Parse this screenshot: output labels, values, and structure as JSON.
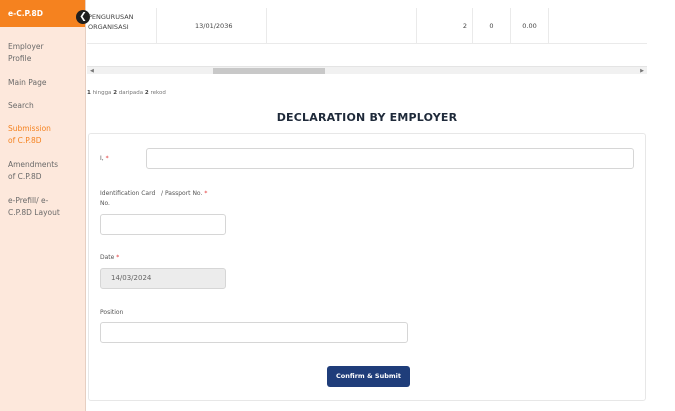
{
  "sidebar": {
    "header": "e-C.P.8D",
    "items": [
      {
        "label": "Employer Profile",
        "lines": [
          "Employer",
          "Profile"
        ],
        "active": false
      },
      {
        "label": "Main Page",
        "lines": [
          "Main Page"
        ],
        "active": false
      },
      {
        "label": "Search",
        "lines": [
          "Search"
        ],
        "active": false
      },
      {
        "label": "Submission of C.P.8D",
        "lines": [
          "Submission",
          "of C.P.8D"
        ],
        "active": true
      },
      {
        "label": "Amendments of C.P.8D",
        "lines": [
          "Amendments",
          "of C.P.8D"
        ],
        "active": false
      },
      {
        "label": "e-Prefill/ e-C.P.8D Layout",
        "lines": [
          "e-Prefill/ e-",
          "C.P.8D Layout"
        ],
        "active": false
      }
    ],
    "collapse_icon": "chevron-left-icon"
  },
  "table": {
    "row": {
      "name_lines": [
        "PENGURUSAN",
        "ORGANISASI"
      ],
      "date": "13/01/2036",
      "count_a": "2",
      "count_b": "0",
      "amount": "0.00"
    }
  },
  "pagination": {
    "from": "1",
    "text_middle": " hingga ",
    "to": "2",
    "text_end": " daripada ",
    "total": "2",
    "suffix": " rekod"
  },
  "declaration": {
    "title": "DECLARATION BY EMPLOYER",
    "i_label": "I, ",
    "id_label_left": "Identification Card",
    "id_label_right": "/ Passport No. ",
    "id_label_no": "No.",
    "date_label": "Date ",
    "date_value": "14/03/2024",
    "position_label": "Position",
    "required_mark": "*",
    "submit_label": "Confirm & Submit"
  },
  "colors": {
    "accent": "#f5821f",
    "sidebar_bg": "#fde8dc",
    "button": "#1f3d7a",
    "required": "#e23b3b"
  }
}
